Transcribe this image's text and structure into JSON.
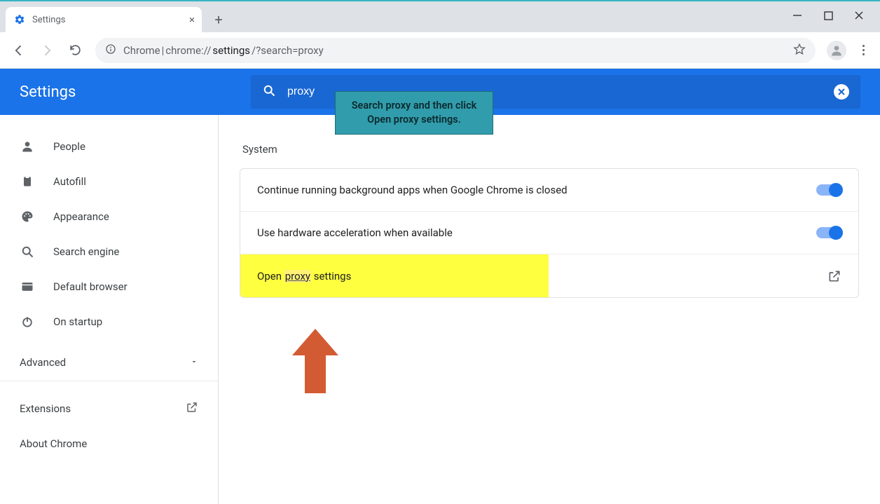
{
  "window": {
    "tab_title": "Settings",
    "url_prefix": "Chrome",
    "url_sep": " | ",
    "url_pre_path": "chrome://",
    "url_mid": "settings",
    "url_rest": "/?search=proxy"
  },
  "header": {
    "brand": "Settings",
    "search_value": "proxy"
  },
  "sidebar": {
    "items": [
      {
        "label": "People",
        "icon": "person"
      },
      {
        "label": "Autofill",
        "icon": "clipboard"
      },
      {
        "label": "Appearance",
        "icon": "palette"
      },
      {
        "label": "Search engine",
        "icon": "search"
      },
      {
        "label": "Default browser",
        "icon": "browser"
      },
      {
        "label": "On startup",
        "icon": "power"
      }
    ],
    "advanced": "Advanced",
    "extensions": "Extensions",
    "about": "About Chrome"
  },
  "main": {
    "section_title": "System",
    "rows": [
      {
        "label": "Continue running background apps when Google Chrome is closed",
        "type": "toggle"
      },
      {
        "label": "Use hardware acceleration when available",
        "type": "toggle"
      },
      {
        "label_pre": "Open ",
        "label_hl": "proxy",
        "label_post": " settings",
        "type": "launch",
        "highlighted": true
      }
    ]
  },
  "callout": "Search proxy and then click Open proxy settings."
}
